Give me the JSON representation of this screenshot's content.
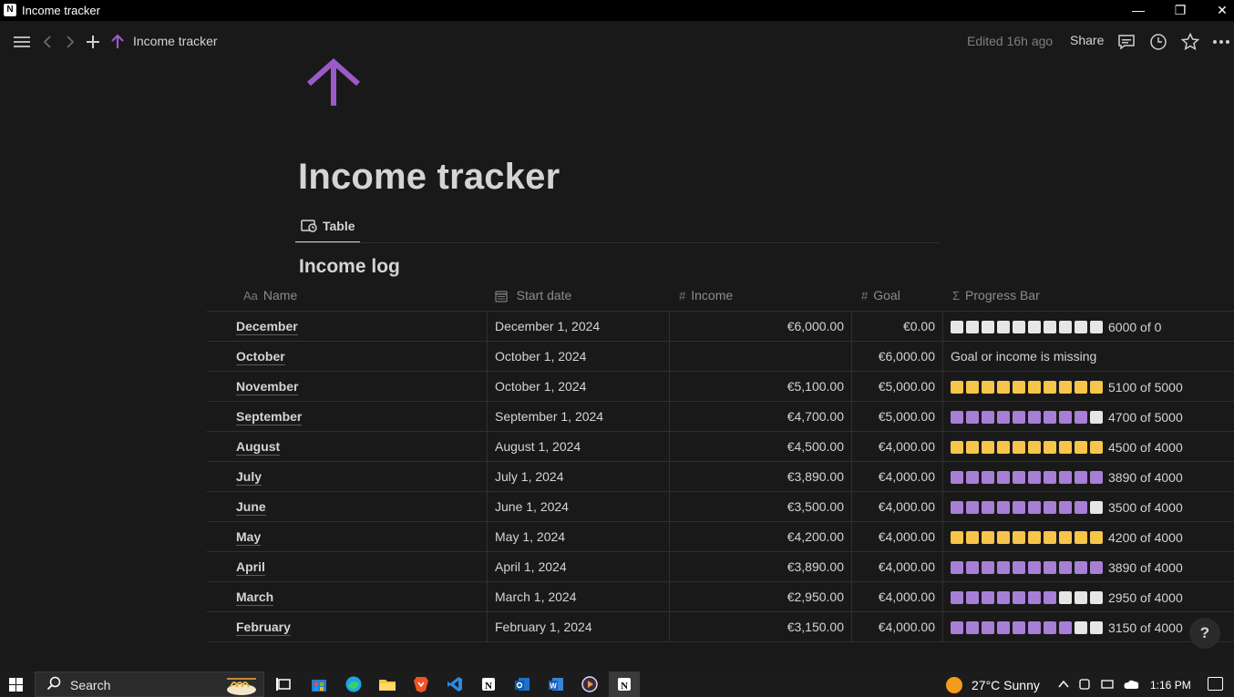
{
  "window": {
    "title": "Income tracker"
  },
  "topbar": {
    "breadcrumb": "Income tracker",
    "edited": "Edited 16h ago",
    "share": "Share"
  },
  "page": {
    "title": "Income tracker",
    "icon": "arrow-up-icon",
    "icon_color": "#9b59c9",
    "view_tab": "Table",
    "database_title": "Income log"
  },
  "table": {
    "columns": [
      {
        "icon": "Aa",
        "label": "Name"
      },
      {
        "icon": "calendar",
        "label": "Start date"
      },
      {
        "icon": "#",
        "label": "Income"
      },
      {
        "icon": "#",
        "label": "Goal"
      },
      {
        "icon": "Σ",
        "label": "Progress Bar"
      }
    ],
    "rows": [
      {
        "name": "December",
        "start": "December 1, 2024",
        "income": "€6,000.00",
        "goal": "€0.00",
        "progress": {
          "filled": 0,
          "total": 10,
          "color": "off",
          "text": "6000 of 0"
        }
      },
      {
        "name": "October",
        "start": "October 1, 2024",
        "income": "",
        "goal": "€6,000.00",
        "progress": {
          "filled": null,
          "total": 0,
          "color": "none",
          "text": "Goal or income is missing"
        }
      },
      {
        "name": "November",
        "start": "October 1, 2024",
        "income": "€5,100.00",
        "goal": "€5,000.00",
        "progress": {
          "filled": 10,
          "total": 10,
          "color": "gold",
          "text": "5100 of 5000"
        }
      },
      {
        "name": "September",
        "start": "September 1, 2024",
        "income": "€4,700.00",
        "goal": "€5,000.00",
        "progress": {
          "filled": 9,
          "total": 10,
          "color": "purple",
          "text": "4700 of 5000"
        }
      },
      {
        "name": "August",
        "start": "August 1, 2024",
        "income": "€4,500.00",
        "goal": "€4,000.00",
        "progress": {
          "filled": 10,
          "total": 10,
          "color": "gold",
          "text": "4500 of 4000"
        }
      },
      {
        "name": "July",
        "start": "July 1, 2024",
        "income": "€3,890.00",
        "goal": "€4,000.00",
        "progress": {
          "filled": 10,
          "total": 10,
          "color": "purple",
          "text": "3890 of 4000"
        }
      },
      {
        "name": "June",
        "start": "June 1, 2024",
        "income": "€3,500.00",
        "goal": "€4,000.00",
        "progress": {
          "filled": 9,
          "total": 10,
          "color": "purple",
          "text": "3500 of 4000"
        }
      },
      {
        "name": "May",
        "start": "May 1, 2024",
        "income": "€4,200.00",
        "goal": "€4,000.00",
        "progress": {
          "filled": 10,
          "total": 10,
          "color": "gold",
          "text": "4200 of 4000"
        }
      },
      {
        "name": "April",
        "start": "April 1, 2024",
        "income": "€3,890.00",
        "goal": "€4,000.00",
        "progress": {
          "filled": 10,
          "total": 10,
          "color": "purple",
          "text": "3890 of 4000"
        }
      },
      {
        "name": "March",
        "start": "March 1, 2024",
        "income": "€2,950.00",
        "goal": "€4,000.00",
        "progress": {
          "filled": 7,
          "total": 10,
          "color": "purple",
          "text": "2950 of 4000"
        }
      },
      {
        "name": "February",
        "start": "February 1, 2024",
        "income": "€3,150.00",
        "goal": "€4,000.00",
        "progress": {
          "filled": 8,
          "total": 10,
          "color": "purple",
          "text": "3150 of 4000"
        }
      }
    ]
  },
  "help": "?",
  "taskbar": {
    "search_placeholder": "Search",
    "weather": "27°C  Sunny",
    "time": "1:16 PM"
  }
}
